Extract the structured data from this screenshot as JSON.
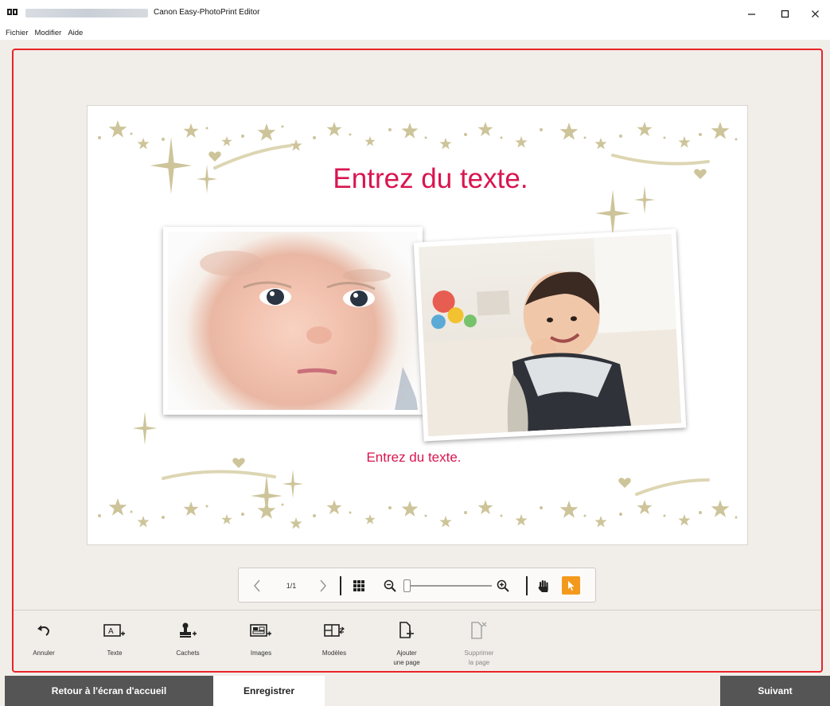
{
  "window": {
    "title": "Canon Easy-PhotoPrint Editor",
    "icons": {
      "app": "canon-app-icon",
      "minimize": "minimize-icon",
      "maximize": "maximize-icon",
      "close": "close-icon"
    }
  },
  "menu": {
    "items": [
      {
        "label": "Fichier"
      },
      {
        "label": "Modifier"
      },
      {
        "label": "Aide"
      }
    ]
  },
  "canvas": {
    "heading_text": "Entrez du texte.",
    "sub_text": "Entrez du texte.",
    "text_color": "#d9154f",
    "decoration_color": "#cdc49a",
    "photos": [
      {
        "name": "baby-face-closeup"
      },
      {
        "name": "baby-smiling-indoors"
      }
    ]
  },
  "navigator": {
    "page_indicator": "1/1",
    "icons": {
      "prev": "chevron-left-icon",
      "next": "chevron-right-icon",
      "thumbnails": "grid-icon",
      "zoom_out": "zoom-out-icon",
      "zoom_in": "zoom-in-icon",
      "pan": "hand-icon",
      "select": "pointer-icon"
    },
    "zoom_level": 0.0,
    "select_tool_color": "#f39a1e"
  },
  "tools": [
    {
      "label": "Annuler",
      "icon": "undo-icon",
      "enabled": true
    },
    {
      "label": "Texte",
      "icon": "add-text-icon",
      "enabled": true
    },
    {
      "label": "Cachets",
      "icon": "stamp-icon",
      "enabled": true
    },
    {
      "label": "Images",
      "icon": "add-image-icon",
      "enabled": true
    },
    {
      "label": "Modèles",
      "icon": "templates-icon",
      "enabled": true
    },
    {
      "label_line1": "Ajouter",
      "label_line2": "une page",
      "icon": "add-page-icon",
      "enabled": true
    },
    {
      "label_line1": "Supprimer",
      "label_line2": "la page",
      "icon": "delete-page-icon",
      "enabled": false
    }
  ],
  "bottom": {
    "home_label": "Retour à l'écran d'accueil",
    "save_label": "Enregistrer",
    "next_label": "Suivant",
    "button_color": "#555555"
  },
  "highlight_color": "#e8232a"
}
